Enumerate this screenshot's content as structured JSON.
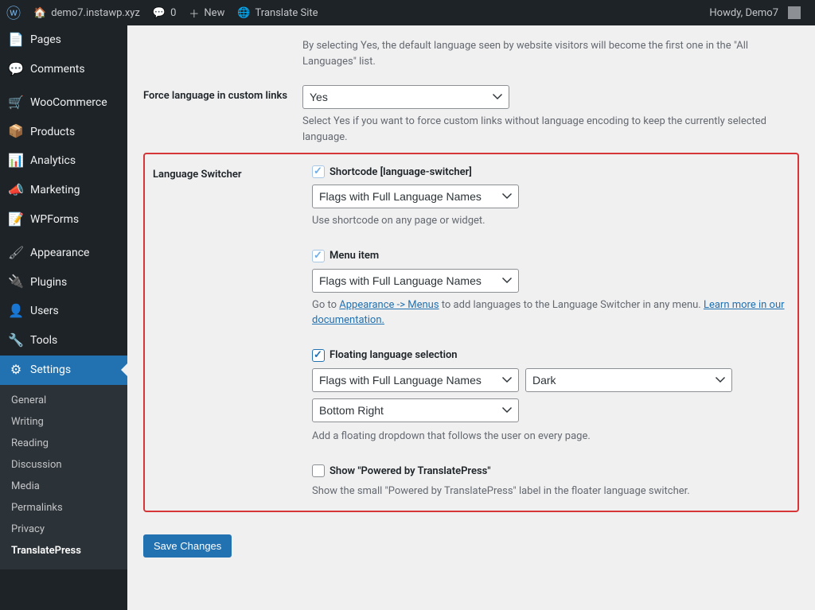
{
  "adminbar": {
    "site_title": "demo7.instawp.xyz",
    "comments_count": "0",
    "new_label": "New",
    "translate_label": "Translate Site",
    "howdy": "Howdy, Demo7"
  },
  "sidebar": {
    "items": [
      {
        "icon": "📄",
        "label": "Pages"
      },
      {
        "icon": "💬",
        "label": "Comments"
      },
      {
        "icon": "🛒",
        "label": "WooCommerce"
      },
      {
        "icon": "📦",
        "label": "Products"
      },
      {
        "icon": "📊",
        "label": "Analytics"
      },
      {
        "icon": "📣",
        "label": "Marketing"
      },
      {
        "icon": "📝",
        "label": "WPForms"
      },
      {
        "icon": "🖌",
        "label": "Appearance"
      },
      {
        "icon": "🔌",
        "label": "Plugins"
      },
      {
        "icon": "👤",
        "label": "Users"
      },
      {
        "icon": "🔧",
        "label": "Tools"
      },
      {
        "icon": "⚙",
        "label": "Settings"
      }
    ],
    "submenu": [
      {
        "label": "General"
      },
      {
        "label": "Writing"
      },
      {
        "label": "Reading"
      },
      {
        "label": "Discussion"
      },
      {
        "label": "Media"
      },
      {
        "label": "Permalinks"
      },
      {
        "label": "Privacy"
      },
      {
        "label": "TranslatePress"
      }
    ]
  },
  "settings": {
    "default_lang_desc": "By selecting Yes, the default language seen by website visitors will become the first one in the \"All Languages\" list.",
    "force_links": {
      "label": "Force language in custom links",
      "value": "Yes",
      "desc": "Select Yes if you want to force custom links without language encoding to keep the currently selected language."
    },
    "switcher": {
      "label": "Language Switcher",
      "shortcode": {
        "label": "Shortcode [language-switcher]",
        "select": "Flags with Full Language Names",
        "desc": "Use shortcode on any page or widget."
      },
      "menuitem": {
        "label": "Menu item",
        "select": "Flags with Full Language Names",
        "desc_pre": "Go to ",
        "link1": "Appearance -> Menus",
        "desc_mid": " to add languages to the Language Switcher in any menu. ",
        "link2": "Learn more in our documentation."
      },
      "floating": {
        "label": "Floating language selection",
        "select_style": "Flags with Full Language Names",
        "select_theme": "Dark",
        "select_pos": "Bottom Right",
        "desc": "Add a floating dropdown that follows the user on every page."
      },
      "powered": {
        "label": "Show \"Powered by TranslatePress\"",
        "desc": "Show the small \"Powered by TranslatePress\" label in the floater language switcher."
      }
    },
    "save_label": "Save Changes"
  }
}
